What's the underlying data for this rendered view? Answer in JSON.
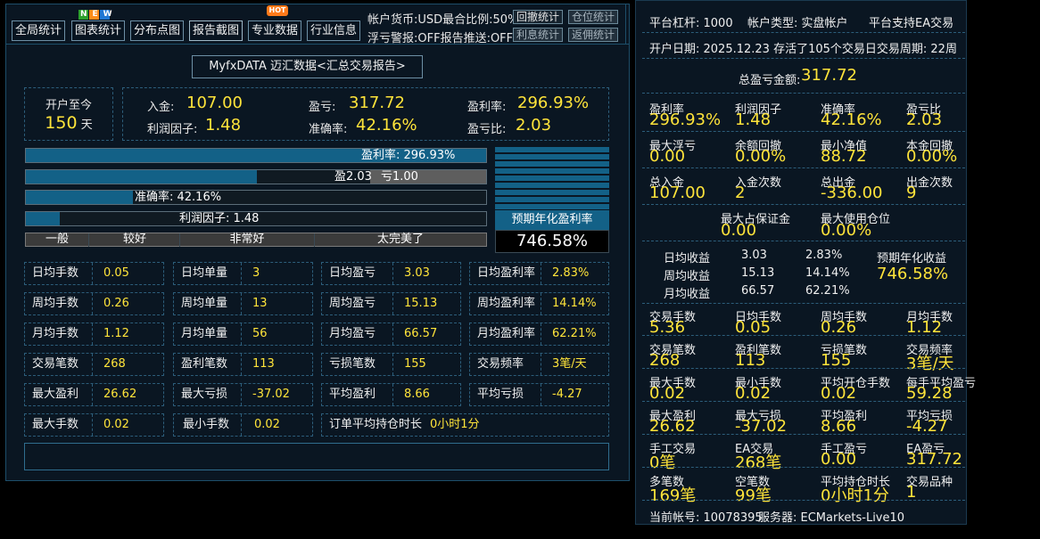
{
  "toolbar": {
    "buttons": [
      "全局统计",
      "图表统计",
      "分布点图",
      "报告截图",
      "专业数据",
      "行业信息"
    ],
    "badges": {
      "new": "NEW",
      "hot": "HOT"
    },
    "info_line1": "帐户货币:USD最合比例:50%",
    "info_line2": "浮亏警报:OFF报告推送:OFF",
    "btn_withdraw": "回撤统计",
    "btn_position": "仓位统计",
    "btn_interest": "利息统计",
    "btn_rebate": "返佣统计"
  },
  "report_title": "MyfxDATA 迈汇数据<汇总交易报告>",
  "open": {
    "label": "开户至今",
    "days": "150",
    "unit": "天"
  },
  "summary": {
    "deposit_label": "入金:",
    "deposit": "107.00",
    "pnl_label": "盈亏:",
    "pnl": "317.72",
    "profit_rate_label": "盈利率:",
    "profit_rate": "296.93%",
    "profit_factor_label": "利润因子:",
    "profit_factor": "1.48",
    "accuracy_label": "准确率:",
    "accuracy": "42.16%",
    "pl_ratio_label": "盈亏比:",
    "pl_ratio": "2.03"
  },
  "bars": {
    "profit_rate_text": "盈利率:  296.93%",
    "profit_rate_fill": 1.0,
    "win_text": "盈2.03",
    "loss_text": "亏1.00",
    "win_share": 0.67,
    "accuracy_text": "准确率:  42.16%",
    "accuracy_fill": 0.4216,
    "factor_text": "利润因子:  1.48",
    "factor_fill": 0.148,
    "scale": [
      "一般",
      "较好",
      "非常好",
      "太完美了"
    ]
  },
  "annual": {
    "label": "预期年化盈利率",
    "value": "746.58%"
  },
  "stats": [
    [
      [
        "日均手数",
        "0.05"
      ],
      [
        "日均单量",
        "3"
      ],
      [
        "日均盈亏",
        "3.03"
      ],
      [
        "日均盈利率",
        "2.83%"
      ]
    ],
    [
      [
        "周均手数",
        "0.26"
      ],
      [
        "周均单量",
        "13"
      ],
      [
        "周均盈亏",
        "15.13"
      ],
      [
        "周均盈利率",
        "14.14%"
      ]
    ],
    [
      [
        "月均手数",
        "1.12"
      ],
      [
        "月均单量",
        "56"
      ],
      [
        "月均盈亏",
        "66.57"
      ],
      [
        "月均盈利率",
        "62.21%"
      ]
    ],
    [
      [
        "交易笔数",
        "268"
      ],
      [
        "盈利笔数",
        "113"
      ],
      [
        "亏损笔数",
        "155"
      ],
      [
        "交易频率",
        "3笔/天"
      ]
    ],
    [
      [
        "最大盈利",
        "26.62"
      ],
      [
        "最大亏损",
        "-37.02"
      ],
      [
        "平均盈利",
        "8.66"
      ],
      [
        "平均亏损",
        "-4.27"
      ]
    ]
  ],
  "last_row": {
    "max_lots_label": "最大手数",
    "max_lots": "0.02",
    "min_lots_label": "最小手数",
    "min_lots": "0.02",
    "avg_hold_label": "订单平均持仓时长",
    "avg_hold": "0小时1分"
  },
  "right": {
    "leverage": "平台杠杆:  1000",
    "acct_type": "帐户类型:  实盘帐户",
    "ea": "平台支持EA交易",
    "open_date": "开户日期:  2025.12.23  存活了105个交易日交易周期:  22周",
    "total_pnl_label": "总盈亏金额:",
    "total_pnl": "317.72",
    "grid1": [
      [
        [
          "盈利率",
          "296.93%"
        ],
        [
          "利润因子",
          "1.48"
        ],
        [
          "准确率",
          "42.16%"
        ],
        [
          "盈亏比",
          "2.03"
        ]
      ],
      [
        [
          "最大浮亏",
          "0.00"
        ],
        [
          "余额回撤",
          "0.00%"
        ],
        [
          "最小净值",
          "88.72"
        ],
        [
          "本金回撤",
          "0.00%"
        ]
      ],
      [
        [
          "总入金",
          "107.00"
        ],
        [
          "入金次数",
          "2"
        ],
        [
          "总出金",
          "-336.00"
        ],
        [
          "出金次数",
          "9"
        ]
      ]
    ],
    "margin_label": "最大占保证金",
    "margin": "0.00",
    "pos_label": "最大使用仓位",
    "pos": "0.00%",
    "daily": [
      "日均收益",
      "3.03",
      "2.83%"
    ],
    "weekly": [
      "周均收益",
      "15.13",
      "14.14%"
    ],
    "monthly": [
      "月均收益",
      "66.57",
      "62.21%"
    ],
    "annual_label": "预期年化收益",
    "annual": "746.58%",
    "grid2": [
      [
        [
          "交易手数",
          "5.36"
        ],
        [
          "日均手数",
          "0.05"
        ],
        [
          "周均手数",
          "0.26"
        ],
        [
          "月均手数",
          "1.12"
        ]
      ],
      [
        [
          "交易笔数",
          "268"
        ],
        [
          "盈利笔数",
          "113"
        ],
        [
          "亏损笔数",
          "155"
        ],
        [
          "交易频率",
          "3笔/天"
        ]
      ],
      [
        [
          "最大手数",
          "0.02"
        ],
        [
          "最小手数",
          "0.02"
        ],
        [
          "平均开仓手数",
          "0.02"
        ],
        [
          "每手平均盈亏",
          "59.28"
        ]
      ],
      [
        [
          "最大盈利",
          "26.62"
        ],
        [
          "最大亏损",
          "-37.02"
        ],
        [
          "平均盈利",
          "8.66"
        ],
        [
          "平均亏损",
          "-4.27"
        ]
      ],
      [
        [
          "手工交易",
          "0笔"
        ],
        [
          "EA交易",
          "268笔"
        ],
        [
          "手工盈亏",
          "0.00"
        ],
        [
          "EA盈亏",
          "317.72"
        ]
      ],
      [
        [
          "多笔数",
          "169笔"
        ],
        [
          "空笔数",
          "99笔"
        ],
        [
          "平均持仓时长",
          "0小时1分"
        ],
        [
          "交易品种",
          "1"
        ]
      ]
    ],
    "account": "当前帐号:  10078395",
    "server": "服务器:  ECMarkets-Live10"
  }
}
